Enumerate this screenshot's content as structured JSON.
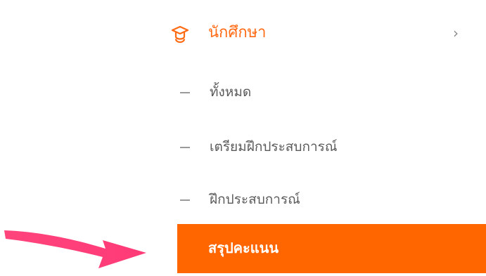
{
  "top_partial_text": {
    "left_fragment": "ู",
    "right_fragment": "ู",
    "far_right_fragment": "ุ"
  },
  "sidebar": {
    "section": {
      "icon": "graduation-cap-icon",
      "label": "นักศึกษา",
      "chevron": "›",
      "color": "#ff6a13"
    },
    "items": [
      {
        "label": "ทั้งหมด",
        "active": false
      },
      {
        "label": "เตรียมฝึกประสบการณ์",
        "active": false
      },
      {
        "label": "ฝึกประสบการณ์",
        "active": false
      },
      {
        "label": "สรุปคะแนน",
        "active": true
      }
    ],
    "active_color": "#ff6600"
  },
  "annotation": {
    "icon": "pointer-arrow-icon",
    "color": "#ff3d7a"
  }
}
